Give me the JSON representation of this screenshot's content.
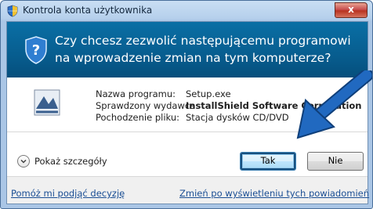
{
  "window": {
    "title": "Kontrola konta użytkownika",
    "close_label": "x"
  },
  "header": {
    "question": "Czy chcesz zezwolić następującemu programowi na wprowadzenie zmian na tym komputerze?"
  },
  "info": {
    "rows": [
      {
        "label": "Nazwa programu:",
        "value": "Setup.exe"
      },
      {
        "label": "Sprawdzony wydawca:",
        "value": "InstallShield Software Corporation"
      },
      {
        "label": "Pochodzenie pliku:",
        "value": "Stacja dysków CD/DVD"
      }
    ]
  },
  "details": {
    "label": "Pokaż szczegóły"
  },
  "buttons": {
    "yes": "Tak",
    "no": "Nie"
  },
  "footer": {
    "help_link": "Pomóż mi podjąć decyzję",
    "notify_link": "Zmień po wyświetleniu tych powiadomień"
  },
  "colors": {
    "header_blue": "#075d8f",
    "arrow_blue": "#1f5fb0",
    "link": "#1a4e94"
  }
}
